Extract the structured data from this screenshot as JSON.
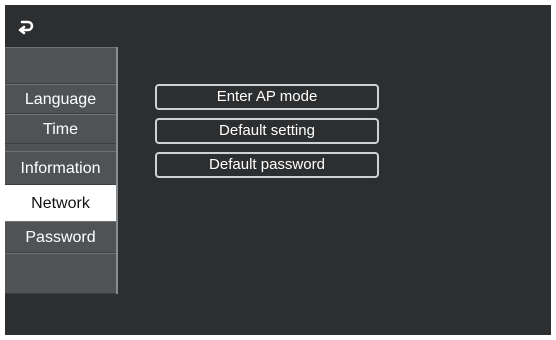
{
  "header": {
    "back_icon": "back-arrow-icon"
  },
  "sidebar": {
    "items": [
      {
        "label": ""
      },
      {
        "label": "Language"
      },
      {
        "label": "Time"
      },
      {
        "label": "Information"
      },
      {
        "label": "Network",
        "active": true
      },
      {
        "label": "Password"
      },
      {
        "label": ""
      }
    ]
  },
  "main": {
    "buttons": [
      {
        "label": "Enter AP mode"
      },
      {
        "label": "Default setting"
      },
      {
        "label": "Default password"
      }
    ]
  },
  "colors": {
    "background": "#2c2e30",
    "sidebar": "#505356",
    "active_item": "#ffffff",
    "button_border": "#cfd2d5"
  }
}
